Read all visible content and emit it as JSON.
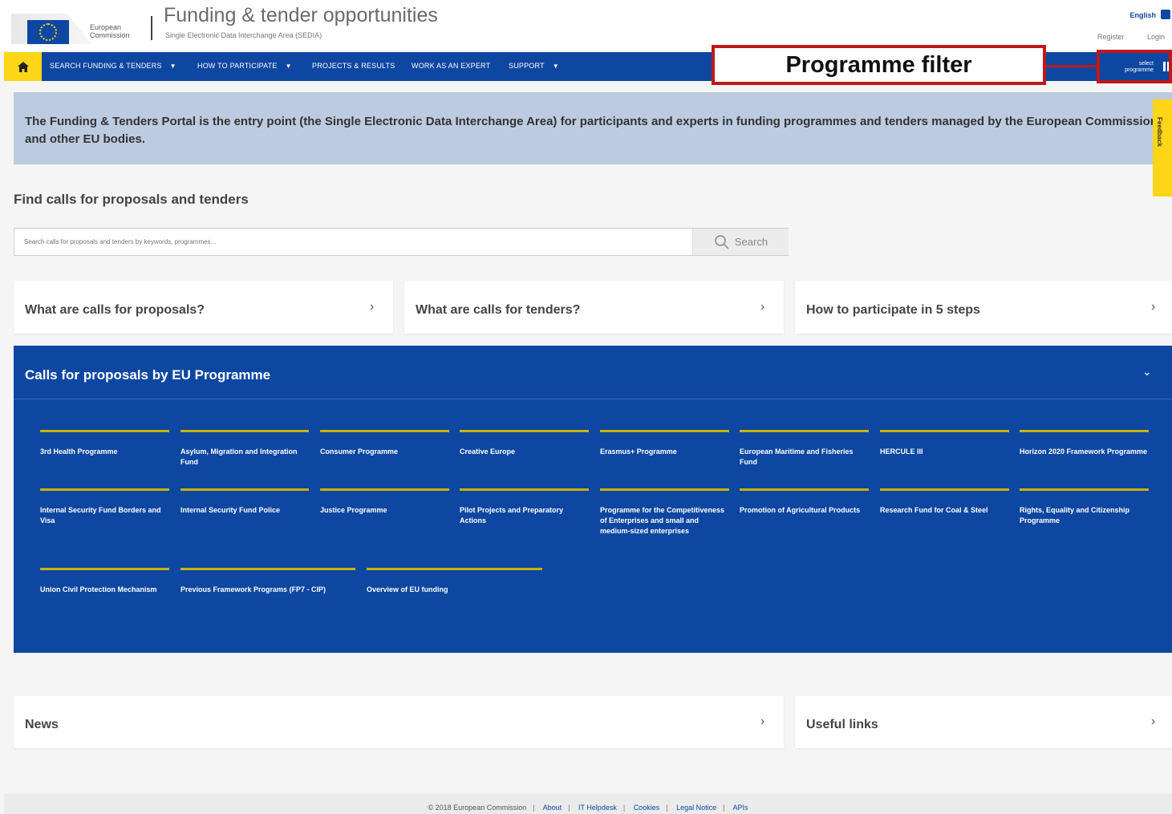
{
  "header": {
    "org_line1": "European",
    "org_line2": "Commission",
    "title": "Funding & tender opportunities",
    "subtitle": "Single Electronic Data Interchange Area (SEDIA)",
    "language": "English",
    "register": "Register",
    "login": "Login"
  },
  "nav": {
    "items": [
      {
        "label": "SEARCH FUNDING & TENDERS",
        "dropdown": true
      },
      {
        "label": "HOW TO PARTICIPATE",
        "dropdown": true
      },
      {
        "label": "PROJECTS & RESULTS",
        "dropdown": false
      },
      {
        "label": "WORK AS AN EXPERT",
        "dropdown": false
      },
      {
        "label": "SUPPORT",
        "dropdown": true
      }
    ],
    "caret": "▼",
    "select_programme": "select programme"
  },
  "callout": {
    "text": "Programme filter",
    "color": "#c01818"
  },
  "intro": "The Funding & Tenders Portal is the entry point (the Single Electronic Data Interchange Area) for participants and experts in funding programmes and tenders managed by the European Commission and other EU bodies.",
  "feedback": "Feedback",
  "find": {
    "title": "Find calls for proposals and tenders",
    "placeholder": "Search calls for proposals and tenders by keywords, programmes...",
    "search_label": "Search"
  },
  "cards": {
    "proposals": "What are calls for proposals?",
    "tenders": "What are calls for tenders?",
    "steps": "How to participate in 5 steps",
    "news": "News",
    "links": "Useful links"
  },
  "programmes": {
    "title": "Calls for proposals by EU Programme",
    "items": [
      "3rd Health Programme",
      "Asylum, Migration and Integration Fund",
      "Consumer Programme",
      "Creative Europe",
      "Erasmus+ Programme",
      "European Maritime and Fisheries Fund",
      "HERCULE III",
      "Horizon 2020 Framework Programme",
      "Internal Security Fund Borders and Visa",
      "Internal Security Fund Police",
      "Justice Programme",
      "Pilot Projects and Preparatory Actions",
      "Programme for the Competitiveness of Enterprises and small and medium-sized enterprises",
      "Promotion of Agricultural Products",
      "Research Fund for Coal & Steel",
      "Rights, Equality and Citizenship Programme",
      "Union Civil Protection Mechanism",
      "Previous Framework Programs (FP7 - CIP)",
      "Overview of EU funding"
    ]
  },
  "footer": {
    "copyright": "© 2018 European Commission",
    "links": [
      "About",
      "IT Helpdesk",
      "Cookies",
      "Legal Notice",
      "APIs"
    ]
  },
  "colors": {
    "brand_blue": "#0e47a1",
    "accent_yellow": "#ffd617",
    "intro_bg": "#bccbe0",
    "programme_bar": "#c7b200"
  }
}
